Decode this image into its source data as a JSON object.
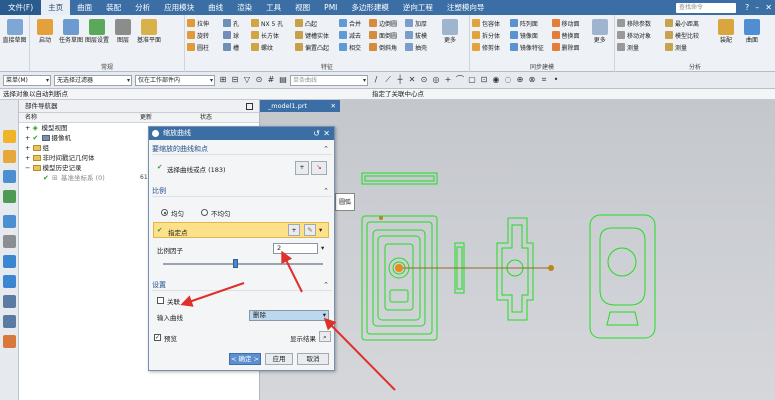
{
  "menubar": {
    "file": "文件(F)",
    "items": [
      "主页",
      "曲面",
      "装配",
      "分析",
      "应用模块",
      "曲线",
      "渲染",
      "工具",
      "视图",
      "PMI",
      "多边形建模",
      "逆向工程",
      "注塑模向导"
    ],
    "active_index": 0,
    "search_placeholder": "查找命令",
    "window_controls": [
      "?",
      "–",
      "✕"
    ]
  },
  "ribbon": {
    "directsketch": {
      "big": [
        "直接草图"
      ]
    },
    "group_cg": {
      "big": [
        "启动",
        "任务草图",
        "图层设置",
        "图层",
        "基准平面"
      ],
      "label": "常规"
    },
    "feature": {
      "cols": [
        [
          "拉伸",
          "旋转",
          "圆柱"
        ],
        [
          "孔",
          "球",
          "槽"
        ],
        [
          "NX 5 孔",
          "长方体",
          "螺纹"
        ],
        [
          "凸起",
          "键槽实体",
          "偏置凸起"
        ],
        [
          "合并",
          "减去",
          "相交"
        ],
        [
          "边倒圆",
          "面倒圆",
          "倒斜角"
        ],
        [
          "加厚",
          "拔模",
          "抽壳"
        ]
      ],
      "big": [
        "更多"
      ],
      "label": "特征"
    },
    "sync": {
      "cols": [
        [
          "包容体",
          "拆分体",
          "修剪体"
        ],
        [
          "阵列面",
          "镜像面",
          "镜像特征"
        ],
        [
          "移动面",
          "替换面",
          "删除面"
        ]
      ],
      "big": [
        "更多"
      ],
      "label": "同步建模"
    },
    "analysis": {
      "cols": [
        [
          "移除参数",
          "移动对象",
          "测量"
        ],
        [
          "最小距离",
          "模型比较",
          "测量"
        ]
      ],
      "big": [
        "装配",
        "曲面"
      ],
      "label": "分析"
    }
  },
  "toolbar2": {
    "menu": "菜单(M)",
    "filter": "无选择过滤器",
    "scope": "仅在工作部件内",
    "curve_type": "单条曲线"
  },
  "status": {
    "left": "选择对象以自动判断点",
    "center": "指定了关联中心点"
  },
  "navigator": {
    "title": "部件导航器",
    "columns": [
      "名称",
      "更新",
      "状态"
    ],
    "rows": [
      {
        "label": "模型视图",
        "tag": ""
      },
      {
        "label": "摄像机",
        "tag": ""
      },
      {
        "label": "组",
        "tag": ""
      },
      {
        "label": "非时间戳记几何体",
        "tag": ""
      },
      {
        "label": "模型历史记录",
        "tag": ""
      },
      {
        "label": "基准坐标系 (0)",
        "tag": "61"
      }
    ]
  },
  "graphics": {
    "tab": "_model1.prt",
    "tab_close": "✕"
  },
  "dialog": {
    "title": "缩放曲线",
    "section_curves": "要缩放的曲线和点",
    "select_curve": "选择曲线或点 (183)",
    "section_scale": "比例",
    "radio_uniform": "均匀",
    "radio_nonuniform": "不均匀",
    "specify_point": "指定点",
    "scale_factor_label": "比例因子",
    "scale_factor": "2",
    "scale_slider": 0.45,
    "section_settings": "设置",
    "associate": "关联",
    "input_curve_label": "输入曲线",
    "input_curve_value": "删除",
    "preview": "预览",
    "show_result": "显示结果",
    "ok": "< 确定 >",
    "apply": "应用",
    "cancel": "取消"
  },
  "tooltip": "圆弧",
  "colors": {
    "accent": "#3b6ea5",
    "highlight": "#fde08a",
    "annotation": "#e0302a",
    "geometry": "#22dd22"
  }
}
